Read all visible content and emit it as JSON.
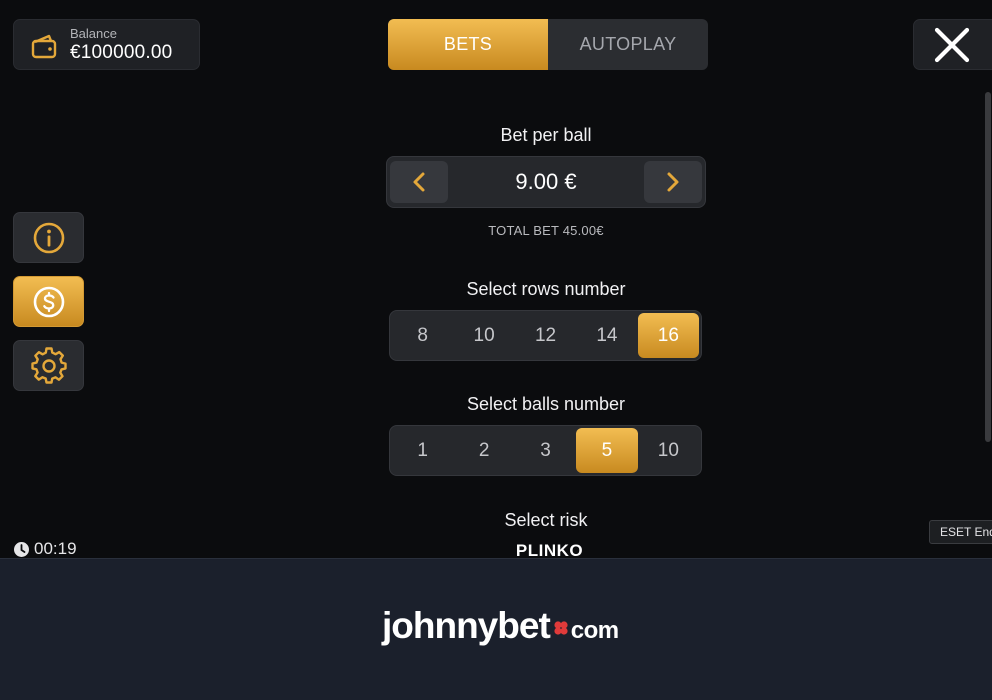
{
  "balance": {
    "label": "Balance",
    "value": "€100000.00"
  },
  "tabs": [
    {
      "label": "BETS",
      "active": true
    },
    {
      "label": "AUTOPLAY",
      "active": false
    }
  ],
  "side_buttons": [
    {
      "icon": "info-icon",
      "active": false
    },
    {
      "icon": "dollar-coin-icon",
      "active": true
    },
    {
      "icon": "gear-icon",
      "active": false
    }
  ],
  "bet": {
    "title": "Bet per ball",
    "value": "9.00 €",
    "total": "TOTAL BET 45.00€"
  },
  "rows": {
    "title": "Select rows number",
    "options": [
      "8",
      "10",
      "12",
      "14",
      "16"
    ],
    "selected": "16"
  },
  "balls": {
    "title": "Select balls number",
    "options": [
      "1",
      "2",
      "3",
      "5",
      "10"
    ],
    "selected": "5"
  },
  "risk": {
    "title": "Select risk"
  },
  "game_name": "PLINKO",
  "timer": "00:19",
  "eset_label": "ESET End",
  "footer": {
    "logo_main": "johnnybet",
    "logo_tld": "com"
  },
  "colors": {
    "accent": "#e4a83a",
    "background": "#0b0c0e",
    "footer_bg": "#1b202c"
  }
}
